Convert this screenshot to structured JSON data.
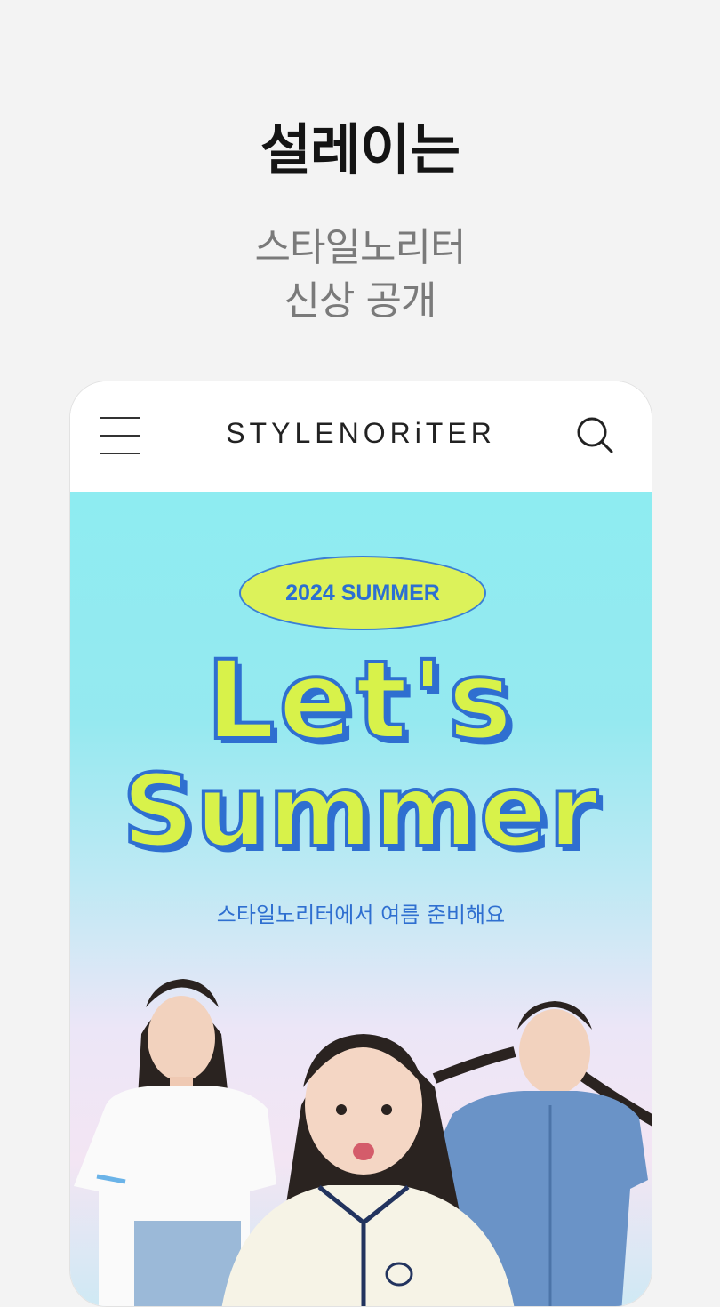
{
  "promo": {
    "headline": "설레이는",
    "subline_1": "스타일노리터",
    "subline_2": "신상 공개"
  },
  "app": {
    "logo": "STYLENORiTER",
    "menu_icon": "hamburger-menu-icon",
    "search_icon": "search-icon"
  },
  "banner": {
    "badge": "2024 SUMMER",
    "title_line_1": "Let's",
    "title_line_2": "Summer",
    "subtitle": "스타일노리터에서 여름 준비해요",
    "colors": {
      "accent_yellow": "#d8f24a",
      "accent_blue": "#2f6fd0",
      "sky_top": "#8eecf1"
    }
  }
}
